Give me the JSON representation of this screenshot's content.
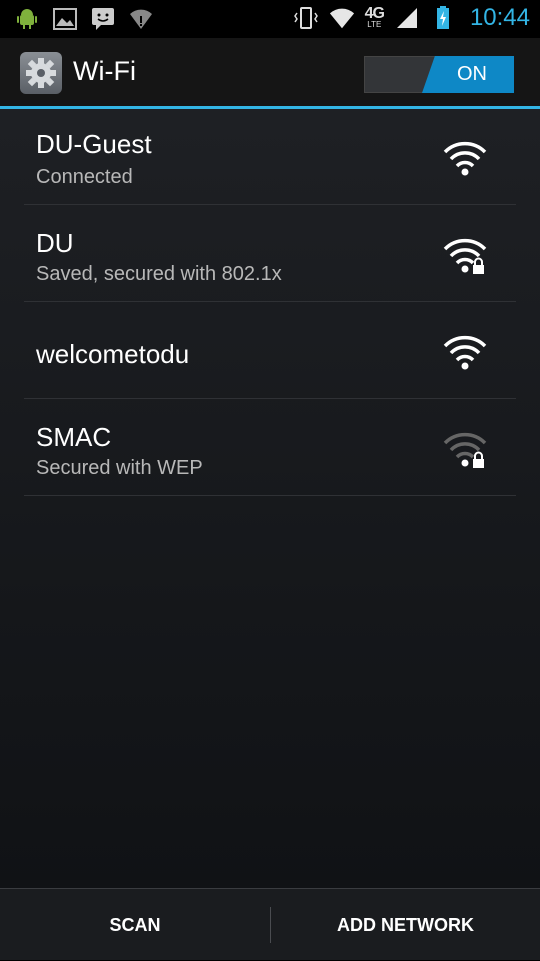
{
  "status_bar": {
    "time": "10:44",
    "network_type": "4G",
    "network_sub": "LTE",
    "icons_left": [
      "android-icon",
      "image-icon",
      "chat-icon",
      "wifi-alert-icon"
    ],
    "icons_right": [
      "vibrate-icon",
      "wifi-icon",
      "lte-icon",
      "cell-signal-icon",
      "battery-icon"
    ]
  },
  "action_bar": {
    "title": "Wi-Fi",
    "toggle_label": "ON",
    "accent_color": "#33b5e5"
  },
  "networks": [
    {
      "ssid": "DU-Guest",
      "summary": "Connected",
      "secured": false,
      "signal": 4
    },
    {
      "ssid": "DU",
      "summary": "Saved, secured with 802.1x",
      "secured": true,
      "signal": 4
    },
    {
      "ssid": "welcometodu",
      "summary": "",
      "secured": false,
      "signal": 4
    },
    {
      "ssid": "SMAC",
      "summary": "Secured with WEP",
      "secured": true,
      "signal": 1
    }
  ],
  "bottom_bar": {
    "scan_label": "SCAN",
    "add_network_label": "ADD NETWORK"
  }
}
